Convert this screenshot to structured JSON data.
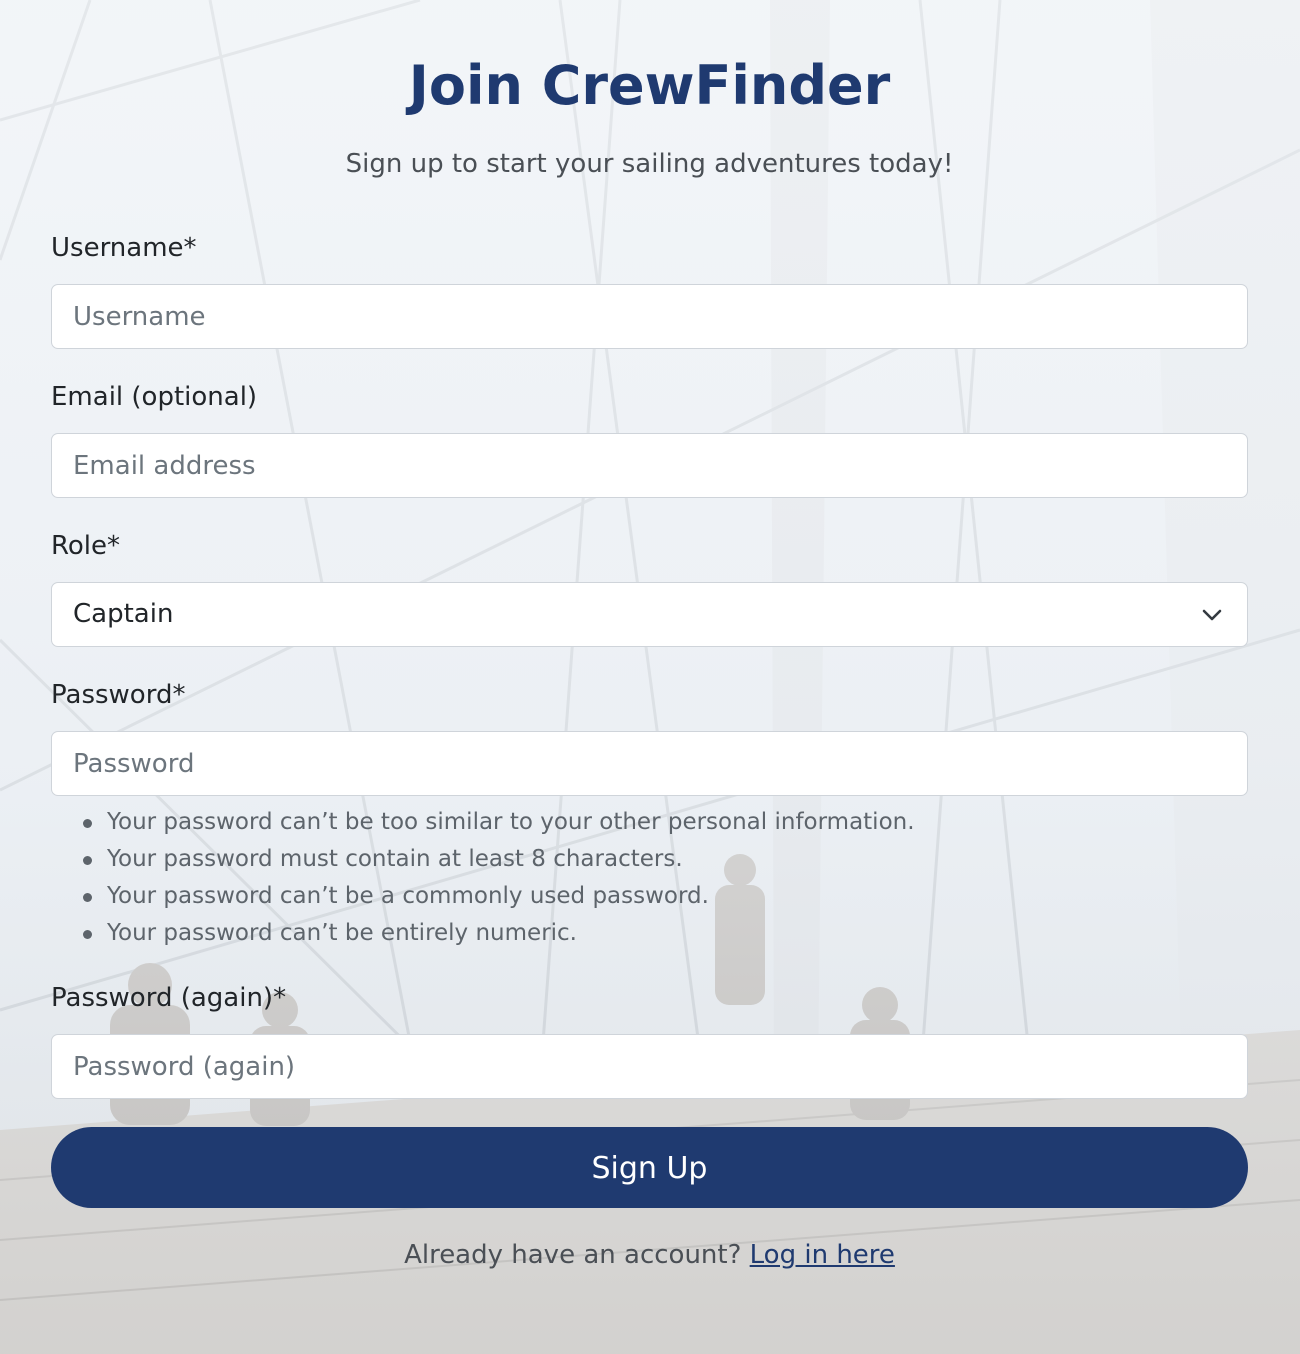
{
  "header": {
    "title": "Join CrewFinder",
    "subtitle": "Sign up to start your sailing adventures today!"
  },
  "form": {
    "username": {
      "label": "Username*",
      "placeholder": "Username",
      "value": ""
    },
    "email": {
      "label": "Email (optional)",
      "placeholder": "Email address",
      "value": ""
    },
    "role": {
      "label": "Role*",
      "selected": "Captain"
    },
    "password": {
      "label": "Password*",
      "placeholder": "Password",
      "value": "",
      "help": [
        "Your password can’t be too similar to your other personal information.",
        "Your password must contain at least 8 characters.",
        "Your password can’t be a commonly used password.",
        "Your password can’t be entirely numeric."
      ]
    },
    "password_again": {
      "label": "Password (again)*",
      "placeholder": "Password (again)",
      "value": ""
    },
    "submit_label": "Sign Up"
  },
  "footer": {
    "prompt": "Already have an account?",
    "login_link": "Log in here"
  },
  "colors": {
    "brand": "#1f3a70",
    "text": "#212529",
    "muted": "#6c757d"
  },
  "icons": {
    "role_select": "chevron-down-icon"
  }
}
